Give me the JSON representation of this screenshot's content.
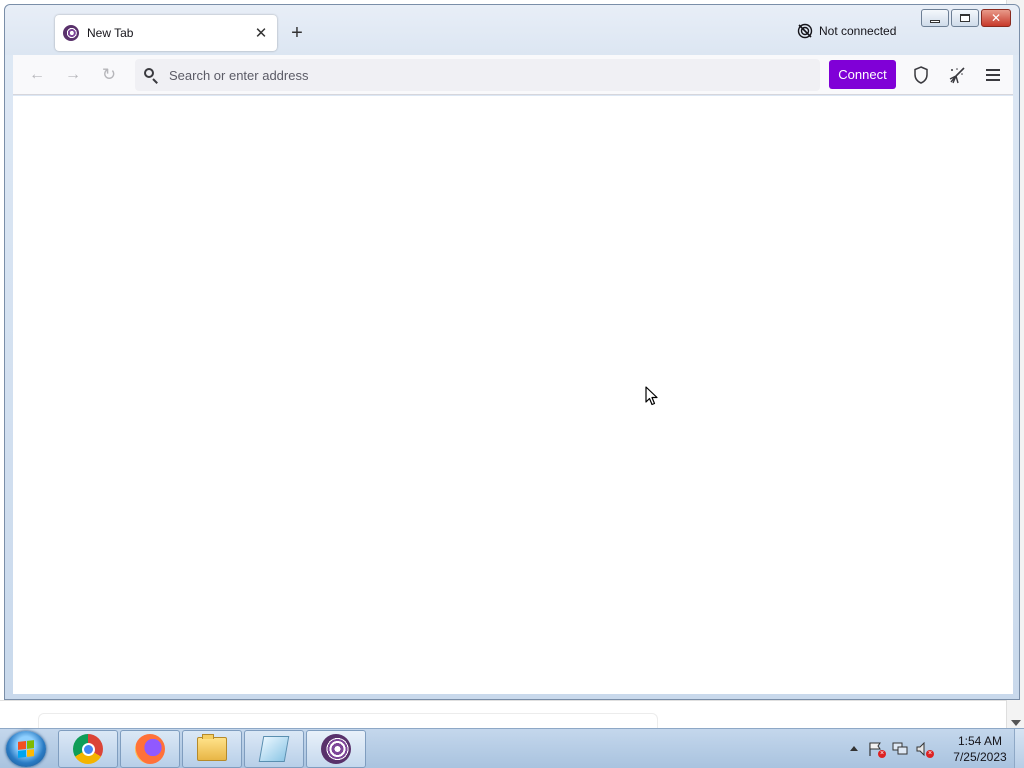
{
  "browser": {
    "tab": {
      "title": "New Tab",
      "close_glyph": "✕",
      "favicon": "tor-browser-icon"
    },
    "new_tab_glyph": "+",
    "status": {
      "label": "Not connected",
      "icon": "no-connection-icon"
    },
    "window_controls": {
      "close_glyph": "✕"
    },
    "nav": {
      "back_glyph": "←",
      "forward_glyph": "→",
      "reload_glyph": "↻"
    },
    "urlbar": {
      "placeholder": "Search or enter address",
      "value": ""
    },
    "connect_label": "Connect",
    "accent_color": "#8000d7"
  },
  "taskbar": {
    "apps": [
      "chrome-icon",
      "firefox-icon",
      "file-explorer-icon",
      "notepad-icon",
      "tor-browser-icon"
    ],
    "clock": {
      "time": "1:54 AM",
      "date": "7/25/2023"
    }
  }
}
